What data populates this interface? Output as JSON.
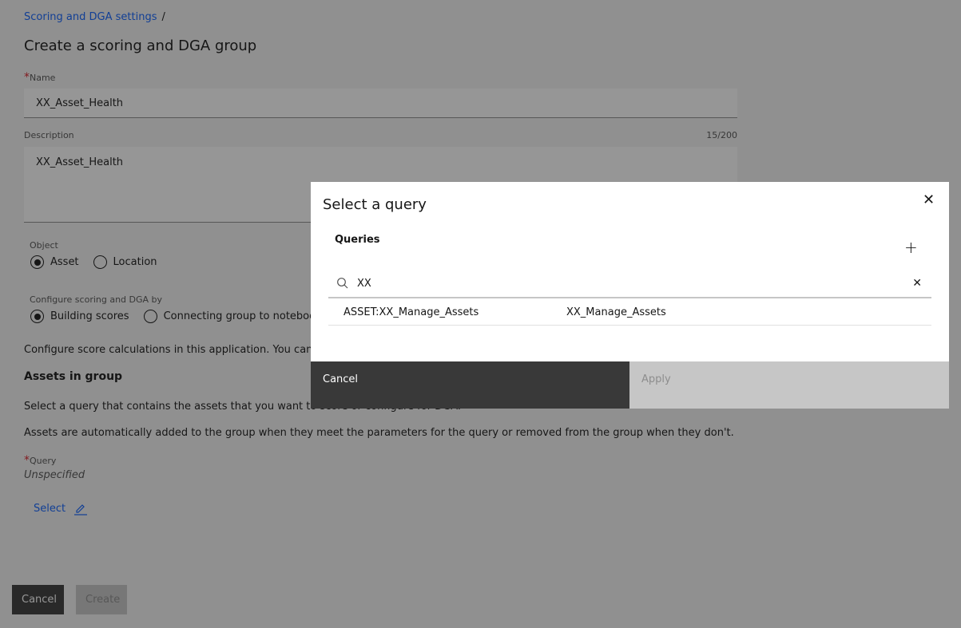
{
  "breadcrumb": {
    "link": "Scoring and DGA settings",
    "separator": "/"
  },
  "page_title": "Create a scoring and DGA group",
  "name_field": {
    "label": "Name",
    "value": "XX_Asset_Health",
    "required_mark": "*"
  },
  "description_field": {
    "label": "Description",
    "value": "XX_Asset_Health",
    "counter": "15/200"
  },
  "object_group": {
    "label": "Object",
    "options": [
      {
        "label": "Asset",
        "selected": true
      },
      {
        "label": "Location",
        "selected": false
      }
    ]
  },
  "configure_group": {
    "label": "Configure scoring and DGA by",
    "options": [
      {
        "label": "Building scores",
        "selected": true
      },
      {
        "label": "Connecting group to notebook",
        "selected": false
      }
    ]
  },
  "configure_text": "Configure score calculations in this application. You can start",
  "assets_section": {
    "heading": "Assets in group",
    "text1": "Select a query that contains the assets that you want to score or configure for DGA.",
    "text2": "Assets are automatically added to the group when they meet the parameters for the query or removed from the group when they don't."
  },
  "query_field": {
    "label": "Query",
    "required_mark": "*",
    "value": "Unspecified",
    "select_link": "Select"
  },
  "footer": {
    "cancel": "Cancel",
    "create": "Create"
  },
  "modal": {
    "title": "Select a query",
    "section": "Queries",
    "search_value": "XX",
    "rows": [
      {
        "name": "ASSET:XX_Manage_Assets",
        "description": "XX_Manage_Assets"
      }
    ],
    "cancel": "Cancel",
    "apply": "Apply"
  },
  "colors": {
    "link": "#0f62fe",
    "required": "#da1e28",
    "primary_button": "#393939",
    "disabled_button": "#c6c6c6"
  }
}
